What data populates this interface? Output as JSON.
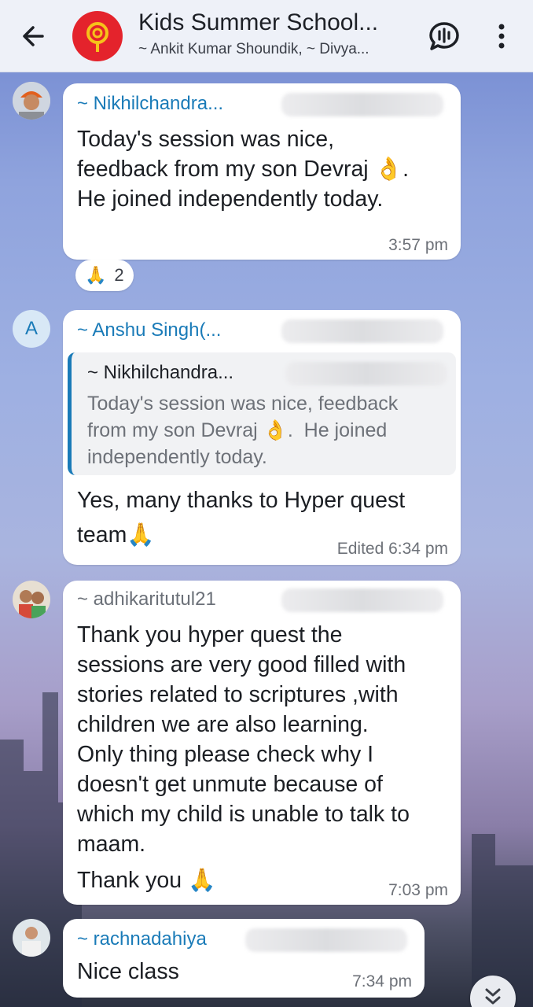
{
  "header": {
    "title": "Kids Summer School...",
    "subtitle": "~ Ankit Kumar Shoundik, ~ Divya...",
    "back_icon": "arrow-left-icon",
    "call_icon": "voice-chat-icon",
    "menu_icon": "more-vert-icon"
  },
  "messages": [
    {
      "sender": "~ Nikhilchandra...",
      "text_line1": "Today's session was nice,",
      "text_line2": "feedback from my son Devraj",
      "text_line2_emoji": "👌",
      "text_line2_tail": ".",
      "text_line3": "He joined independently today.",
      "time": "3:57 pm",
      "reaction_emoji": "🙏",
      "reaction_count": "2"
    },
    {
      "avatar_letter": "A",
      "sender": "~ Anshu Singh(...",
      "quote_sender": "~ Nikhilchandra...",
      "quote_line1": "Today's session was nice, feedback",
      "quote_line2": "from my son Devraj",
      "quote_line2_emoji": "👌",
      "quote_line2_tail": ".  He joined",
      "quote_line3": "independently today.",
      "text_line1": "Yes, many thanks to Hyper quest",
      "text_line2": "team",
      "text_line2_emoji": "🙏",
      "time": "Edited 6:34 pm"
    },
    {
      "sender": "~ adhikaritutul21",
      "lines": [
        "Thank you hyper quest the",
        "sessions are very good filled with",
        "stories related to scriptures ,with",
        "children we are also learning.",
        "Only thing please check why I",
        "doesn't get unmute because of",
        "which my child is unable to talk to",
        "maam."
      ],
      "closing": "Thank you",
      "closing_emoji": "🙏",
      "time": "7:03 pm"
    },
    {
      "sender": "~ rachnadahiya",
      "text": "Nice class",
      "time": "7:34 pm"
    }
  ],
  "scroll_icon": "chevron-double-down-icon",
  "colors": {
    "header_bg": "#eef1f8",
    "sender_blue": "#1a7bb8",
    "bubble_bg": "#ffffff",
    "group_avatar": "#e4232c"
  }
}
